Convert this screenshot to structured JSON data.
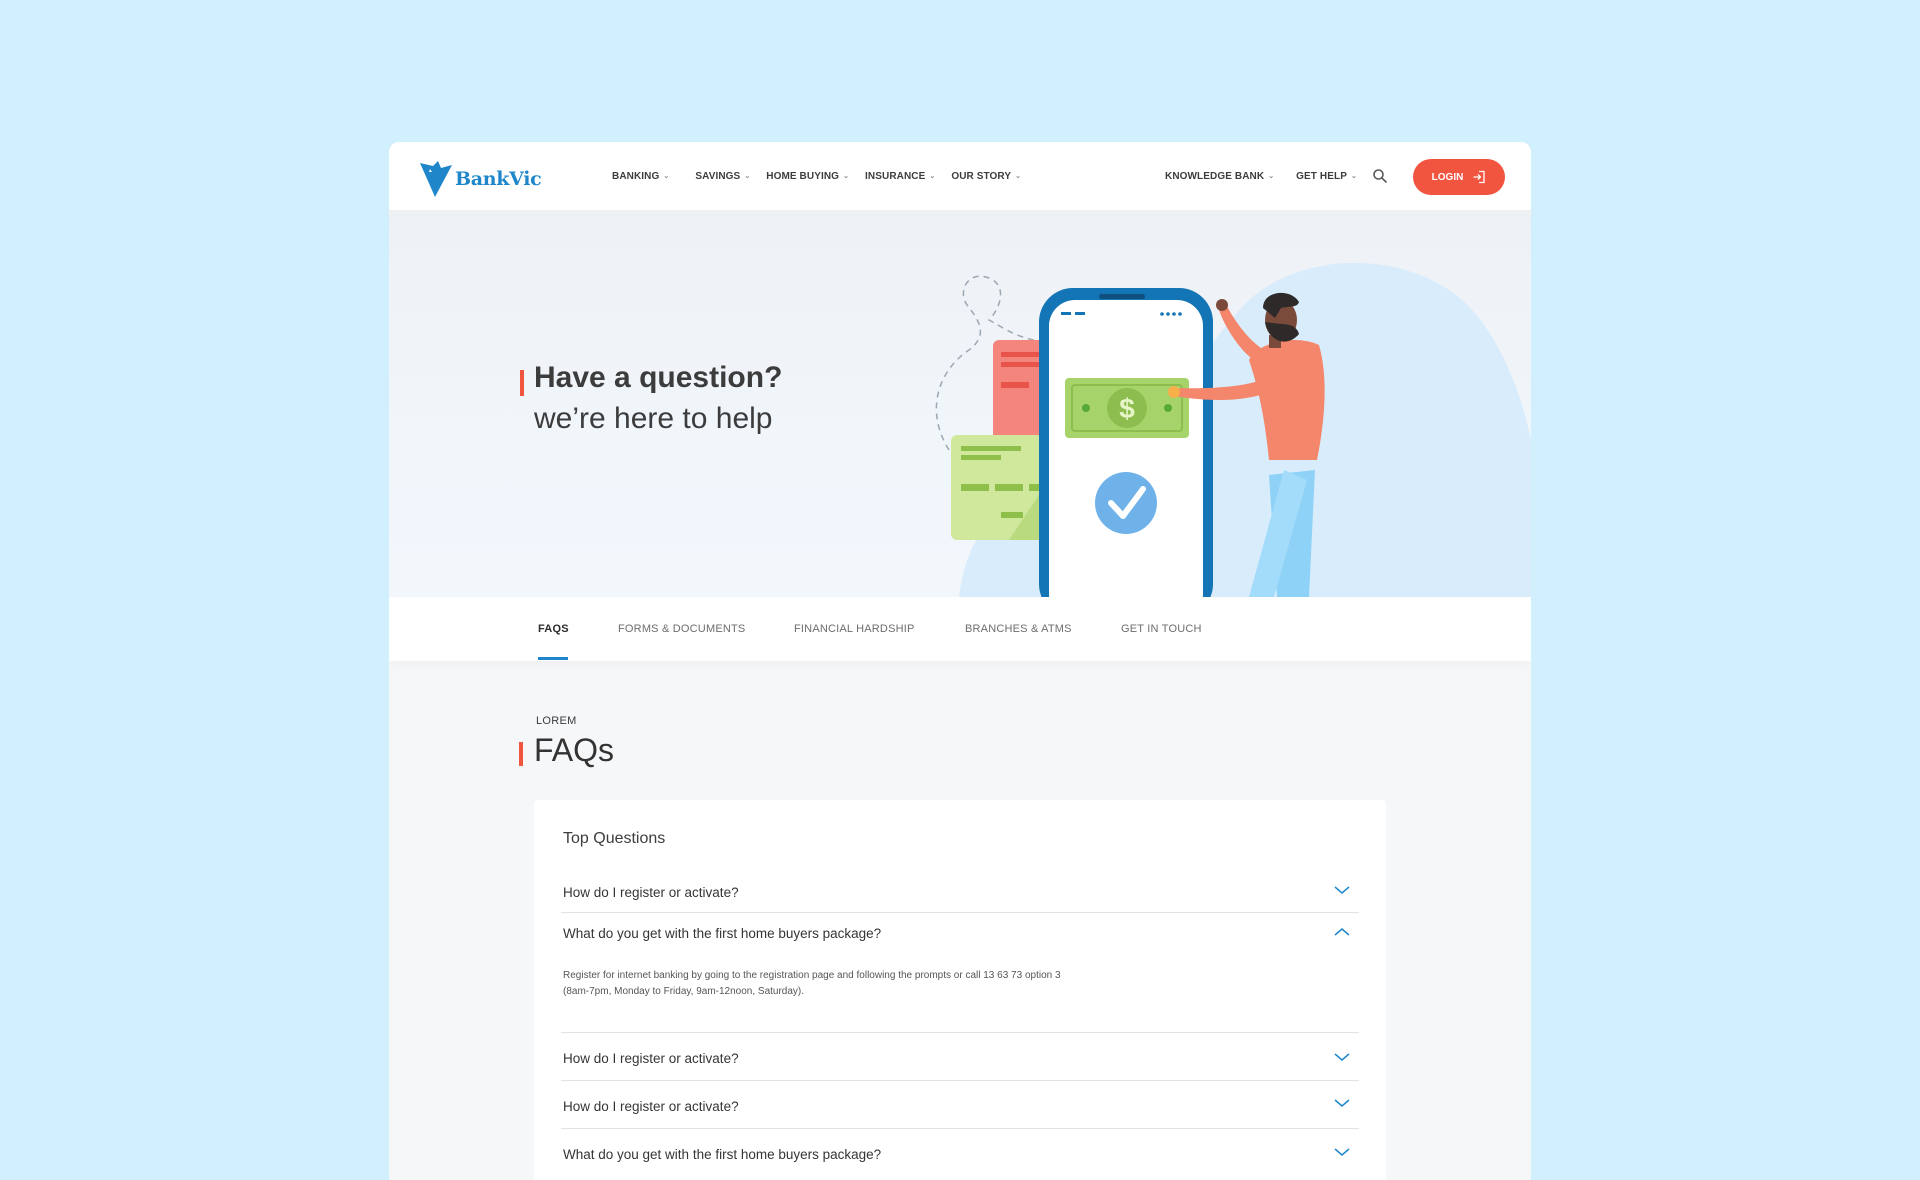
{
  "header": {
    "brand": "BankVic",
    "nav_left": [
      {
        "label": "BANKING"
      },
      {
        "label": "SAVINGS"
      },
      {
        "label": "HOME BUYING"
      },
      {
        "label": "INSURANCE"
      },
      {
        "label": "OUR STORY"
      }
    ],
    "nav_right": [
      {
        "label": "KNOWLEDGE BANK"
      },
      {
        "label": "GET HELP"
      }
    ],
    "login_label": "LOGIN"
  },
  "hero": {
    "title": "Have a question?",
    "subtitle": "we’re here to help"
  },
  "tabs": [
    {
      "label": "FAQS",
      "active": true
    },
    {
      "label": "FORMS & DOCUMENTS"
    },
    {
      "label": "FINANCIAL HARDSHIP"
    },
    {
      "label": "BRANCHES & ATMS"
    },
    {
      "label": "GET IN TOUCH"
    }
  ],
  "faq": {
    "eyebrow": "LOREM",
    "title": "FAQs",
    "section_title": "Top Questions",
    "questions": [
      {
        "text": "How do I register or activate?",
        "expanded": false
      },
      {
        "text": "What do you get with the first home buyers package?",
        "expanded": true,
        "answer_line1": "Register for internet banking by going to the registration page and following the prompts or call 13 63 73 option 3",
        "answer_line2": "(8am-7pm, Monday to Friday, 9am-12noon, Saturday)."
      },
      {
        "text": "How do I register or activate?",
        "expanded": false
      },
      {
        "text": "How do I register or activate?",
        "expanded": false
      },
      {
        "text": "What do you get with the first home buyers package?",
        "expanded": false
      }
    ]
  },
  "colors": {
    "background": "#d2effd",
    "accent": "#f1543f",
    "brand_blue": "#1f87c9"
  },
  "icons": [
    "bankvic-logo-icon",
    "chevron-down-icon",
    "search-icon",
    "login-arrow-icon",
    "chevron-up-icon",
    "dollar-icon",
    "check-icon"
  ]
}
